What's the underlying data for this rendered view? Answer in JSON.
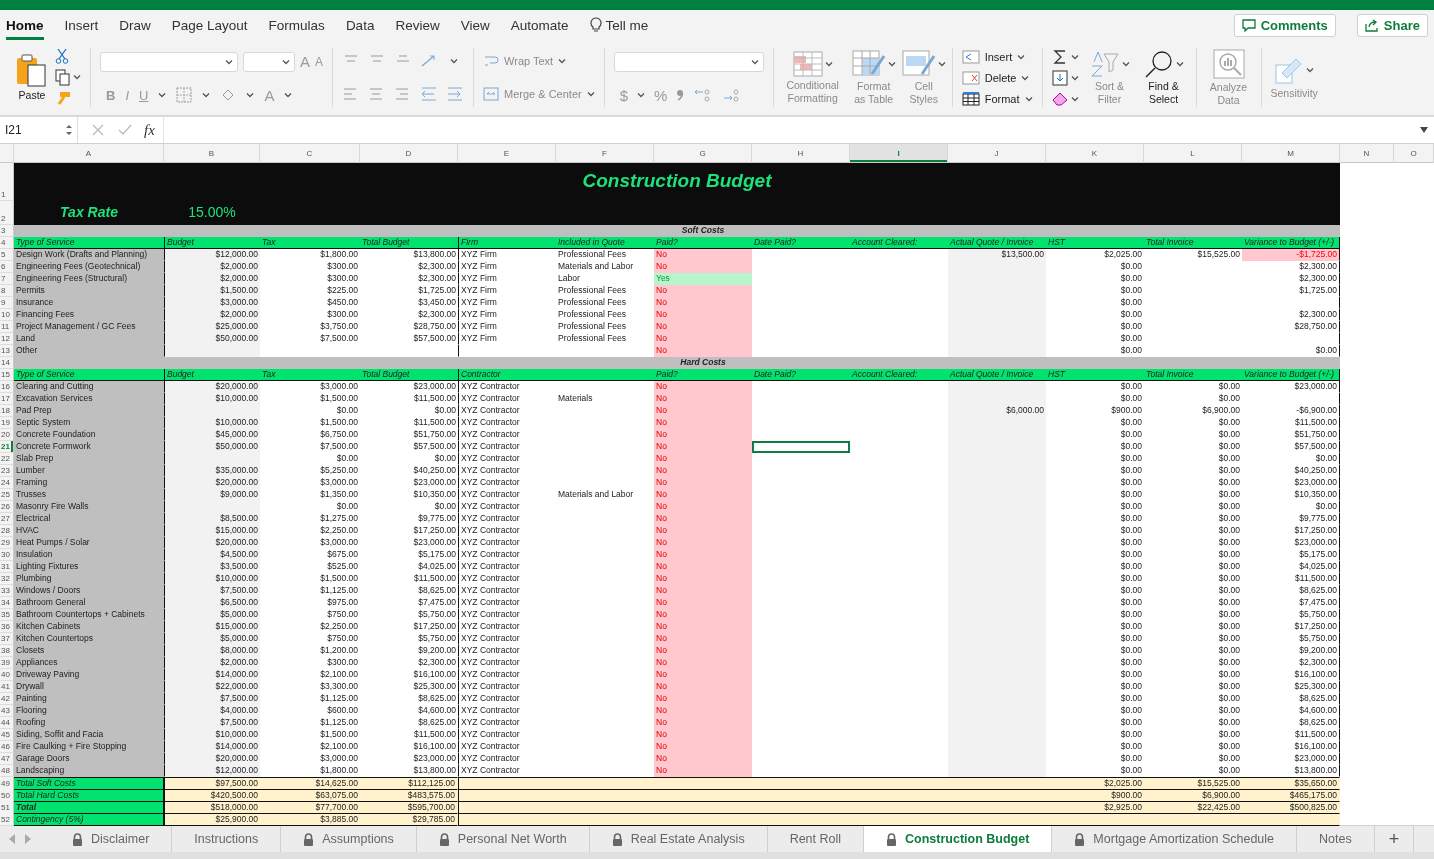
{
  "ribbon_tabs": [
    {
      "label": "Home",
      "selected": true
    },
    {
      "label": "Insert",
      "selected": false
    },
    {
      "label": "Draw",
      "selected": false
    },
    {
      "label": "Page Layout",
      "selected": false
    },
    {
      "label": "Formulas",
      "selected": false
    },
    {
      "label": "Data",
      "selected": false
    },
    {
      "label": "Review",
      "selected": false
    },
    {
      "label": "View",
      "selected": false
    },
    {
      "label": "Automate",
      "selected": false
    }
  ],
  "tell_me": "Tell me",
  "comments": "Comments",
  "share": "Share",
  "ribbon": {
    "paste": {
      "label": "Paste",
      "disabled": false
    },
    "font_glyphs": [
      {
        "kind": "bold",
        "text": "B"
      },
      {
        "kind": "italic",
        "text": "I"
      },
      {
        "kind": "underline",
        "text": "U"
      }
    ],
    "grow_font": "A",
    "shrink_font": "A",
    "font_color": "A",
    "wrap_text": {
      "label": "Wrap Text",
      "disabled": true
    },
    "merge_center": {
      "label": "Merge & Center",
      "disabled": true
    },
    "currency": "$",
    "percent": "%",
    "styles": [
      {
        "kind": "conditional",
        "label": "Conditional Formatting",
        "disabled": true
      },
      {
        "kind": "table",
        "label": "Format as Table",
        "disabled": true
      },
      {
        "kind": "cell",
        "label": "Cell Styles",
        "disabled": true
      }
    ],
    "cells": [
      {
        "kind": "insert",
        "label": "Insert",
        "disabled": false
      },
      {
        "kind": "delete",
        "label": "Delete",
        "disabled": false
      },
      {
        "kind": "format",
        "label": "Format",
        "disabled": false
      }
    ],
    "sort_filter": {
      "label": "Sort & Filter",
      "disabled": true
    },
    "find_select": {
      "label": "Find & Select",
      "disabled": false
    },
    "analyze": {
      "label": "Analyze Data",
      "disabled": true
    },
    "sensitivity": {
      "label": "Sensitivity",
      "disabled": true
    }
  },
  "formula_bar": {
    "name_box": "I21",
    "fx": "fx"
  },
  "sheet": {
    "columns": [
      {
        "label": "A",
        "selected": false
      },
      {
        "label": "B",
        "selected": false
      },
      {
        "label": "C",
        "selected": false
      },
      {
        "label": "D",
        "selected": false
      },
      {
        "label": "E",
        "selected": false
      },
      {
        "label": "F",
        "selected": false
      },
      {
        "label": "G",
        "selected": false
      },
      {
        "label": "H",
        "selected": false
      },
      {
        "label": "I",
        "selected": true
      },
      {
        "label": "J",
        "selected": false
      },
      {
        "label": "K",
        "selected": false
      },
      {
        "label": "L",
        "selected": false
      },
      {
        "label": "M",
        "selected": false
      },
      {
        "label": "N",
        "selected": false
      },
      {
        "label": "O",
        "selected": false
      }
    ],
    "rows": [
      {
        "num": "1",
        "selected": false,
        "kind": "title",
        "text": "Construction Budget"
      },
      {
        "num": "2",
        "selected": false,
        "kind": "tax",
        "label": "Tax Rate",
        "value": "15.00%"
      },
      {
        "num": "3",
        "selected": false,
        "kind": "band",
        "text": "Soft Costs"
      },
      {
        "num": "4",
        "selected": false,
        "kind": "header",
        "cells": [
          "Type of Service",
          "Budget",
          "Tax",
          "Total Budget",
          "Firm",
          "Included in Quote",
          "Paid?",
          "Date Paid?",
          "Account Cleared:",
          "Actual Quote / Invoice",
          "HST",
          "Total Invoice",
          "Variance to Budget (+/-)"
        ]
      },
      {
        "num": "5",
        "selected": false,
        "kind": "item",
        "paid": false,
        "over_budget": true,
        "cells": [
          "Design Work (Drafts and Planning)",
          "$12,000.00",
          "$1,800.00",
          "$13,800.00",
          "XYZ Firm",
          "Professional Fees",
          "No",
          null,
          null,
          "$13,500.00",
          "$2,025.00",
          "$15,525.00",
          "-$1,725.00"
        ]
      },
      {
        "num": "6",
        "selected": false,
        "kind": "item",
        "paid": false,
        "over_budget": false,
        "cells": [
          "Engineering Fees (Geotechnical)",
          "$2,000.00",
          "$300.00",
          "$2,300.00",
          "XYZ Firm",
          "Materials and Labor",
          "No",
          null,
          null,
          null,
          "$0.00",
          null,
          "$2,300.00"
        ]
      },
      {
        "num": "7",
        "selected": false,
        "kind": "item",
        "paid": true,
        "over_budget": false,
        "cells": [
          "Engineering Fees (Structural)",
          "$2,000.00",
          "$300.00",
          "$2,300.00",
          "XYZ Firm",
          "Labor",
          "Yes",
          null,
          null,
          null,
          "$0.00",
          null,
          "$2,300.00"
        ]
      },
      {
        "num": "8",
        "selected": false,
        "kind": "item",
        "paid": false,
        "over_budget": false,
        "cells": [
          "Permits",
          "$1,500.00",
          "$225.00",
          "$1,725.00",
          "XYZ Firm",
          "Professional Fees",
          "No",
          null,
          null,
          null,
          "$0.00",
          null,
          "$1,725.00"
        ]
      },
      {
        "num": "9",
        "selected": false,
        "kind": "item",
        "paid": false,
        "cells": [
          "Insurance",
          "$3,000.00",
          "$450.00",
          "$3,450.00",
          "XYZ Firm",
          "Professional Fees",
          "No",
          null,
          null,
          null,
          "$0.00",
          null,
          null
        ]
      },
      {
        "num": "10",
        "selected": false,
        "kind": "item",
        "paid": false,
        "over_budget": false,
        "cells": [
          "Financing Fees",
          "$2,000.00",
          "$300.00",
          "$2,300.00",
          "XYZ Firm",
          "Professional Fees",
          "No",
          null,
          null,
          null,
          "$0.00",
          null,
          "$2,300.00"
        ]
      },
      {
        "num": "11",
        "selected": false,
        "kind": "item",
        "paid": false,
        "over_budget": false,
        "cells": [
          "Project Management / GC Fees",
          "$25,000.00",
          "$3,750.00",
          "$28,750.00",
          "XYZ Firm",
          "Professional Fees",
          "No",
          null,
          null,
          null,
          "$0.00",
          null,
          "$28,750.00"
        ]
      },
      {
        "num": "12",
        "selected": false,
        "kind": "item",
        "paid": false,
        "cells": [
          "Land",
          "$50,000.00",
          "$7,500.00",
          "$57,500.00",
          "XYZ Firm",
          "Professional Fees",
          "No",
          null,
          null,
          null,
          "$0.00",
          null,
          null
        ]
      },
      {
        "num": "13",
        "selected": false,
        "kind": "item",
        "paid": false,
        "over_budget": false,
        "cells": [
          "Other",
          null,
          null,
          null,
          null,
          null,
          "No",
          null,
          null,
          null,
          "$0.00",
          null,
          "$0.00"
        ]
      },
      {
        "num": "14",
        "selected": false,
        "kind": "band",
        "text": "Hard Costs"
      },
      {
        "num": "15",
        "selected": false,
        "kind": "header",
        "cells": [
          "Type of Service",
          "Budget",
          "Tax",
          "Total Budget",
          "Contractor",
          null,
          "Paid?",
          "Date Paid?",
          "Account Cleared:",
          "Actual Quote / Invoice",
          "HST",
          "Total Invoice",
          "Variance to Budget (+/-)"
        ]
      },
      {
        "num": "16",
        "selected": false,
        "kind": "item",
        "paid": false,
        "over_budget": false,
        "cells": [
          "Clearing and Cutting",
          "$20,000.00",
          "$3,000.00",
          "$23,000.00",
          "XYZ Contractor",
          null,
          "No",
          null,
          null,
          null,
          "$0.00",
          "$0.00",
          "$23,000.00"
        ]
      },
      {
        "num": "17",
        "selected": false,
        "kind": "item",
        "paid": false,
        "cells": [
          "Excavation Services",
          "$10,000.00",
          "$1,500.00",
          "$11,500.00",
          "XYZ Contractor",
          "Materials",
          "No",
          null,
          null,
          null,
          "$0.00",
          "$0.00",
          null
        ]
      },
      {
        "num": "18",
        "selected": false,
        "kind": "item",
        "paid": false,
        "over_budget": false,
        "cells": [
          "Pad Prep",
          null,
          "$0.00",
          "$0.00",
          "XYZ Contractor",
          null,
          "No",
          null,
          null,
          "$6,000.00",
          "$900.00",
          "$6,900.00",
          "-$6,900.00"
        ]
      },
      {
        "num": "19",
        "selected": false,
        "kind": "item",
        "paid": false,
        "over_budget": false,
        "cells": [
          "Septic System",
          "$10,000.00",
          "$1,500.00",
          "$11,500.00",
          "XYZ Contractor",
          null,
          "No",
          null,
          null,
          null,
          "$0.00",
          "$0.00",
          "$11,500.00"
        ]
      },
      {
        "num": "20",
        "selected": false,
        "kind": "item",
        "paid": false,
        "over_budget": false,
        "cells": [
          "Concrete Foundation",
          "$45,000.00",
          "$6,750.00",
          "$51,750.00",
          "XYZ Contractor",
          null,
          "No",
          null,
          null,
          null,
          "$0.00",
          "$0.00",
          "$51,750.00"
        ]
      },
      {
        "num": "21",
        "selected": true,
        "kind": "item",
        "paid": false,
        "over_budget": false,
        "cells": [
          "Concrete Formwork",
          "$50,000.00",
          "$7,500.00",
          "$57,500.00",
          "XYZ Contractor",
          null,
          "No",
          null,
          null,
          null,
          "$0.00",
          "$0.00",
          "$57,500.00"
        ]
      },
      {
        "num": "22",
        "selected": false,
        "kind": "item",
        "paid": false,
        "over_budget": false,
        "cells": [
          "Slab Prep",
          null,
          "$0.00",
          "$0.00",
          "XYZ Contractor",
          null,
          "No",
          null,
          null,
          null,
          "$0.00",
          "$0.00",
          "$0.00"
        ]
      },
      {
        "num": "23",
        "selected": false,
        "kind": "item",
        "paid": false,
        "over_budget": false,
        "cells": [
          "Lumber",
          "$35,000.00",
          "$5,250.00",
          "$40,250.00",
          "XYZ Contractor",
          null,
          "No",
          null,
          null,
          null,
          "$0.00",
          "$0.00",
          "$40,250.00"
        ]
      },
      {
        "num": "24",
        "selected": false,
        "kind": "item",
        "paid": false,
        "over_budget": false,
        "cells": [
          "Framing",
          "$20,000.00",
          "$3,000.00",
          "$23,000.00",
          "XYZ Contractor",
          null,
          "No",
          null,
          null,
          null,
          "$0.00",
          "$0.00",
          "$23,000.00"
        ]
      },
      {
        "num": "25",
        "selected": false,
        "kind": "item",
        "paid": false,
        "over_budget": false,
        "cells": [
          "Trusses",
          "$9,000.00",
          "$1,350.00",
          "$10,350.00",
          "XYZ Contractor",
          "Materials and Labor",
          "No",
          null,
          null,
          null,
          "$0.00",
          "$0.00",
          "$10,350.00"
        ]
      },
      {
        "num": "26",
        "selected": false,
        "kind": "item",
        "paid": false,
        "over_budget": false,
        "cells": [
          "Masonry Fire Walls",
          null,
          "$0.00",
          "$0.00",
          "XYZ Contractor",
          null,
          "No",
          null,
          null,
          null,
          "$0.00",
          "$0.00",
          "$0.00"
        ]
      },
      {
        "num": "27",
        "selected": false,
        "kind": "item",
        "paid": false,
        "over_budget": false,
        "cells": [
          "Electrical",
          "$8,500.00",
          "$1,275.00",
          "$9,775.00",
          "XYZ Contractor",
          null,
          "No",
          null,
          null,
          null,
          "$0.00",
          "$0.00",
          "$9,775.00"
        ]
      },
      {
        "num": "28",
        "selected": false,
        "kind": "item",
        "paid": false,
        "over_budget": false,
        "cells": [
          "HVAC",
          "$15,000.00",
          "$2,250.00",
          "$17,250.00",
          "XYZ Contractor",
          null,
          "No",
          null,
          null,
          null,
          "$0.00",
          "$0.00",
          "$17,250.00"
        ]
      },
      {
        "num": "29",
        "selected": false,
        "kind": "item",
        "paid": false,
        "over_budget": false,
        "cells": [
          "Heat Pumps / Solar",
          "$20,000.00",
          "$3,000.00",
          "$23,000.00",
          "XYZ Contractor",
          null,
          "No",
          null,
          null,
          null,
          "$0.00",
          "$0.00",
          "$23,000.00"
        ]
      },
      {
        "num": "30",
        "selected": false,
        "kind": "item",
        "paid": false,
        "over_budget": false,
        "cells": [
          "Insulation",
          "$4,500.00",
          "$675.00",
          "$5,175.00",
          "XYZ Contractor",
          null,
          "No",
          null,
          null,
          null,
          "$0.00",
          "$0.00",
          "$5,175.00"
        ]
      },
      {
        "num": "31",
        "selected": false,
        "kind": "item",
        "paid": false,
        "over_budget": false,
        "cells": [
          "Lighting Fixtures",
          "$3,500.00",
          "$525.00",
          "$4,025.00",
          "XYZ Contractor",
          null,
          "No",
          null,
          null,
          null,
          "$0.00",
          "$0.00",
          "$4,025.00"
        ]
      },
      {
        "num": "32",
        "selected": false,
        "kind": "item",
        "paid": false,
        "over_budget": false,
        "cells": [
          "Plumbing",
          "$10,000.00",
          "$1,500.00",
          "$11,500.00",
          "XYZ Contractor",
          null,
          "No",
          null,
          null,
          null,
          "$0.00",
          "$0.00",
          "$11,500.00"
        ]
      },
      {
        "num": "33",
        "selected": false,
        "kind": "item",
        "paid": false,
        "over_budget": false,
        "cells": [
          "Windows / Doors",
          "$7,500.00",
          "$1,125.00",
          "$8,625.00",
          "XYZ Contractor",
          null,
          "No",
          null,
          null,
          null,
          "$0.00",
          "$0.00",
          "$8,625.00"
        ]
      },
      {
        "num": "34",
        "selected": false,
        "kind": "item",
        "paid": false,
        "over_budget": false,
        "cells": [
          "Bathroom General",
          "$6,500.00",
          "$975.00",
          "$7,475.00",
          "XYZ Contractor",
          null,
          "No",
          null,
          null,
          null,
          "$0.00",
          "$0.00",
          "$7,475.00"
        ]
      },
      {
        "num": "35",
        "selected": false,
        "kind": "item",
        "paid": false,
        "over_budget": false,
        "cells": [
          "Bathroom Countertops + Cabinets",
          "$5,000.00",
          "$750.00",
          "$5,750.00",
          "XYZ Contractor",
          null,
          "No",
          null,
          null,
          null,
          "$0.00",
          "$0.00",
          "$5,750.00"
        ]
      },
      {
        "num": "36",
        "selected": false,
        "kind": "item",
        "paid": false,
        "over_budget": false,
        "cells": [
          "Kitchen Cabinets",
          "$15,000.00",
          "$2,250.00",
          "$17,250.00",
          "XYZ Contractor",
          null,
          "No",
          null,
          null,
          null,
          "$0.00",
          "$0.00",
          "$17,250.00"
        ]
      },
      {
        "num": "37",
        "selected": false,
        "kind": "item",
        "paid": false,
        "over_budget": false,
        "cells": [
          "Kitchen Countertops",
          "$5,000.00",
          "$750.00",
          "$5,750.00",
          "XYZ Contractor",
          null,
          "No",
          null,
          null,
          null,
          "$0.00",
          "$0.00",
          "$5,750.00"
        ]
      },
      {
        "num": "38",
        "selected": false,
        "kind": "item",
        "paid": false,
        "over_budget": false,
        "cells": [
          "Closets",
          "$8,000.00",
          "$1,200.00",
          "$9,200.00",
          "XYZ Contractor",
          null,
          "No",
          null,
          null,
          null,
          "$0.00",
          "$0.00",
          "$9,200.00"
        ]
      },
      {
        "num": "39",
        "selected": false,
        "kind": "item",
        "paid": false,
        "over_budget": false,
        "cells": [
          "Appliances",
          "$2,000.00",
          "$300.00",
          "$2,300.00",
          "XYZ Contractor",
          null,
          "No",
          null,
          null,
          null,
          "$0.00",
          "$0.00",
          "$2,300.00"
        ]
      },
      {
        "num": "40",
        "selected": false,
        "kind": "item",
        "paid": false,
        "over_budget": false,
        "cells": [
          "Driveway Paving",
          "$14,000.00",
          "$2,100.00",
          "$16,100.00",
          "XYZ Contractor",
          null,
          "No",
          null,
          null,
          null,
          "$0.00",
          "$0.00",
          "$16,100.00"
        ]
      },
      {
        "num": "41",
        "selected": false,
        "kind": "item",
        "paid": false,
        "over_budget": false,
        "cells": [
          "Drywall",
          "$22,000.00",
          "$3,300.00",
          "$25,300.00",
          "XYZ Contractor",
          null,
          "No",
          null,
          null,
          null,
          "$0.00",
          "$0.00",
          "$25,300.00"
        ]
      },
      {
        "num": "42",
        "selected": false,
        "kind": "item",
        "paid": false,
        "over_budget": false,
        "cells": [
          "Painting",
          "$7,500.00",
          "$1,125.00",
          "$8,625.00",
          "XYZ Contractor",
          null,
          "No",
          null,
          null,
          null,
          "$0.00",
          "$0.00",
          "$8,625.00"
        ]
      },
      {
        "num": "43",
        "selected": false,
        "kind": "item",
        "paid": false,
        "over_budget": false,
        "cells": [
          "Flooring",
          "$4,000.00",
          "$600.00",
          "$4,600.00",
          "XYZ Contractor",
          null,
          "No",
          null,
          null,
          null,
          "$0.00",
          "$0.00",
          "$4,600.00"
        ]
      },
      {
        "num": "44",
        "selected": false,
        "kind": "item",
        "paid": false,
        "over_budget": false,
        "cells": [
          "Roofing",
          "$7,500.00",
          "$1,125.00",
          "$8,625.00",
          "XYZ Contractor",
          null,
          "No",
          null,
          null,
          null,
          "$0.00",
          "$0.00",
          "$8,625.00"
        ]
      },
      {
        "num": "45",
        "selected": false,
        "kind": "item",
        "paid": false,
        "over_budget": false,
        "cells": [
          "Siding, Soffit and Facia",
          "$10,000.00",
          "$1,500.00",
          "$11,500.00",
          "XYZ Contractor",
          null,
          "No",
          null,
          null,
          null,
          "$0.00",
          "$0.00",
          "$11,500.00"
        ]
      },
      {
        "num": "46",
        "selected": false,
        "kind": "item",
        "paid": false,
        "over_budget": false,
        "cells": [
          "Fire Caulking + Fire Stopping",
          "$14,000.00",
          "$2,100.00",
          "$16,100.00",
          "XYZ Contractor",
          null,
          "No",
          null,
          null,
          null,
          "$0.00",
          "$0.00",
          "$16,100.00"
        ]
      },
      {
        "num": "47",
        "selected": false,
        "kind": "item",
        "paid": false,
        "over_budget": false,
        "cells": [
          "Garage Doors",
          "$20,000.00",
          "$3,000.00",
          "$23,000.00",
          "XYZ Contractor",
          null,
          "No",
          null,
          null,
          null,
          "$0.00",
          "$0.00",
          "$23,000.00"
        ]
      },
      {
        "num": "48",
        "selected": false,
        "kind": "item",
        "paid": false,
        "over_budget": false,
        "cells": [
          "Landscaping",
          "$12,000.00",
          "$1,800.00",
          "$13,800.00",
          "XYZ Contractor",
          null,
          "No",
          null,
          null,
          null,
          "$0.00",
          "$0.00",
          "$13,800.00"
        ]
      },
      {
        "num": "49",
        "selected": false,
        "kind": "total",
        "emphasis": false,
        "cells": [
          "Total Soft Costs",
          "$97,500.00",
          "$14,625.00",
          "$112,125.00",
          null,
          null,
          null,
          null,
          null,
          null,
          "$2,025.00",
          "$15,525.00",
          "$35,650.00"
        ]
      },
      {
        "num": "50",
        "selected": false,
        "kind": "total",
        "emphasis": false,
        "cells": [
          "Total Hard Costs",
          "$420,500.00",
          "$63,075.00",
          "$483,575.00",
          null,
          null,
          null,
          null,
          null,
          null,
          "$900.00",
          "$6,900.00",
          "$465,175.00"
        ]
      },
      {
        "num": "51",
        "selected": false,
        "kind": "total",
        "emphasis": true,
        "cells": [
          "Total",
          "$518,000.00",
          "$77,700.00",
          "$595,700.00",
          null,
          null,
          null,
          null,
          null,
          null,
          "$2,925.00",
          "$22,425.00",
          "$500,825.00"
        ]
      },
      {
        "num": "52",
        "selected": false,
        "kind": "total",
        "emphasis": false,
        "cells": [
          "Contingency (5%)",
          "$25,900.00",
          "$3,885.00",
          "$29,785.00",
          null,
          null,
          null,
          null,
          null,
          null,
          null,
          null,
          null
        ]
      }
    ]
  },
  "sheet_tabs": [
    {
      "label": "Disclaimer",
      "locked": true,
      "selected": false
    },
    {
      "label": "Instructions",
      "locked": false,
      "selected": false
    },
    {
      "label": "Assumptions",
      "locked": true,
      "selected": false
    },
    {
      "label": "Personal Net Worth",
      "locked": true,
      "selected": false
    },
    {
      "label": "Real Estate Analysis",
      "locked": true,
      "selected": false
    },
    {
      "label": "Rent Roll",
      "locked": false,
      "selected": false
    },
    {
      "label": "Construction Budget",
      "locked": true,
      "selected": true
    },
    {
      "label": "Mortgage Amortization Schedule",
      "locked": true,
      "selected": false
    },
    {
      "label": "Notes",
      "locked": false,
      "selected": false
    }
  ],
  "add_sheet": "+"
}
